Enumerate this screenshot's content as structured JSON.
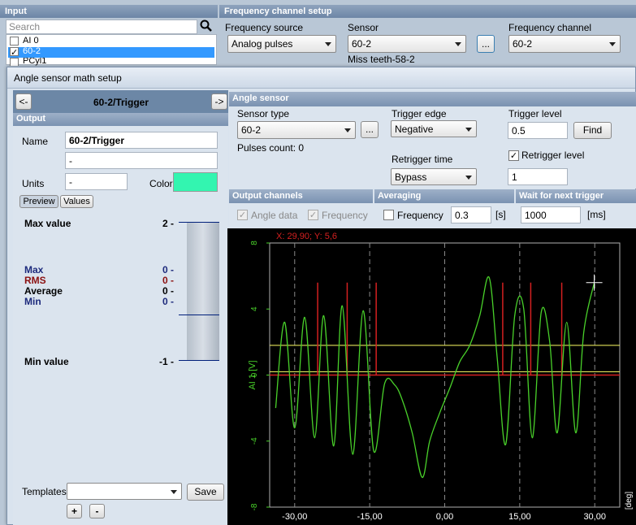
{
  "input_panel": {
    "header": "Input",
    "search_placeholder": "Search",
    "items": [
      {
        "label": "AI 0",
        "checked": false
      },
      {
        "label": "60-2",
        "checked": true
      },
      {
        "label": "PCyl1",
        "checked": false
      }
    ]
  },
  "freq_setup": {
    "header": "Frequency channel setup",
    "source_label": "Frequency source",
    "source_value": "Analog pulses",
    "sensor_label": "Sensor",
    "sensor_value": "60-2",
    "dots_label": "...",
    "channel_label": "Frequency channel",
    "channel_value": "60-2",
    "sensor_caption": "Miss teeth-58-2"
  },
  "dialog": {
    "title": "Angle sensor math setup",
    "nav_prev": "<-",
    "nav_next": "->",
    "nav_title": "60-2/Trigger",
    "output": {
      "header": "Output",
      "name_label": "Name",
      "name_value": "60-2/Trigger",
      "name2_value": "-",
      "units_label": "Units",
      "units_value": "-",
      "color_label": "Color",
      "color_value": "#33f5b0",
      "tab_preview": "Preview",
      "tab_values": "Values"
    },
    "preview": {
      "max_value_label": "Max value",
      "max_value": "2 -",
      "max_label": "Max",
      "max": "0 -",
      "rms_label": "RMS",
      "rms": "0 -",
      "avg_label": "Average",
      "avg": "0 -",
      "min_label": "Min",
      "min": "0 -",
      "min_value_label": "Min value",
      "min_value": "-1 -"
    },
    "templates_label": "Templates",
    "templates_value": "",
    "save_label": "Save",
    "plus_label": "+",
    "minus_label": "-",
    "angle_sensor": {
      "header": "Angle sensor",
      "sensor_type_label": "Sensor type",
      "sensor_type_value": "60-2",
      "dots_label": "...",
      "pulses_count": "Pulses count: 0",
      "trigger_edge_label": "Trigger edge",
      "trigger_edge_value": "Negative",
      "trigger_level_label": "Trigger level",
      "trigger_level_value": "0.5",
      "find_label": "Find",
      "retrigger_time_label": "Retrigger time",
      "retrigger_time_value": "Bypass",
      "retrigger_level_label": "Retrigger level",
      "retrigger_level_checked": true,
      "retrigger_level_value": "1"
    },
    "output_channels": {
      "header": "Output channels",
      "angle_data": "Angle data",
      "frequency": "Frequency"
    },
    "averaging": {
      "header": "Averaging",
      "frequency": "Frequency",
      "value": "0.3",
      "unit": "[s]"
    },
    "wait": {
      "header": "Wait for next trigger",
      "value": "1000",
      "unit": "[ms]"
    }
  },
  "chart_data": {
    "type": "line",
    "cursor_readout": "X: 29,90; Y: 5,6",
    "ylabel": "AI 1 [V]",
    "xlabel": "[deg]",
    "xlim": [
      -35,
      35
    ],
    "ylim": [
      -8,
      8
    ],
    "x_ticks": [
      "-30,00",
      "-15,00",
      "0,00",
      "15,00",
      "30,00"
    ],
    "y_ticks": [
      "8",
      "4",
      "0",
      "-4",
      "-8"
    ],
    "trigger_level": 1.8,
    "retrigger_level": 0.2,
    "trigger_markers_x": [
      -25.4,
      -19.5,
      -13.7,
      11.6,
      17.2,
      23.4
    ],
    "colors": {
      "signal": "#49d12a",
      "trigger": "#d42020",
      "level": "#e4e45a",
      "grid": "#8a8a8a"
    },
    "series": [
      {
        "values": [
          [
            -33.8,
            -2.0
          ],
          [
            -32.0,
            3.2
          ],
          [
            -30.0,
            -3.2
          ],
          [
            -28.0,
            3.5
          ],
          [
            -26.0,
            -3.8
          ],
          [
            -24.2,
            3.6
          ],
          [
            -22.2,
            -4.3
          ],
          [
            -20.5,
            4.2
          ],
          [
            -18.4,
            -4.8
          ],
          [
            -16.3,
            3.9
          ],
          [
            -14.2,
            -4.6
          ],
          [
            -12.0,
            -0.5
          ],
          [
            -10.0,
            -0.6
          ],
          [
            -8.5,
            -1.5
          ],
          [
            -6.5,
            -3.5
          ],
          [
            -4.5,
            -6.2
          ],
          [
            -3.0,
            -4.0
          ],
          [
            -1.0,
            -2.3
          ],
          [
            1.0,
            -0.8
          ],
          [
            3.0,
            0.8
          ],
          [
            5.0,
            1.8
          ],
          [
            7.0,
            3.6
          ],
          [
            8.9,
            5.9
          ],
          [
            10.5,
            1.0
          ],
          [
            12.2,
            -4.2
          ],
          [
            14.0,
            3.6
          ],
          [
            15.8,
            4.0
          ],
          [
            17.5,
            -3.8
          ],
          [
            19.3,
            3.8
          ],
          [
            21.0,
            2.0
          ],
          [
            22.5,
            -3.5
          ],
          [
            24.4,
            3.2
          ],
          [
            26.2,
            -3.5
          ],
          [
            27.8,
            2.6
          ],
          [
            29.9,
            5.6
          ]
        ]
      }
    ]
  }
}
